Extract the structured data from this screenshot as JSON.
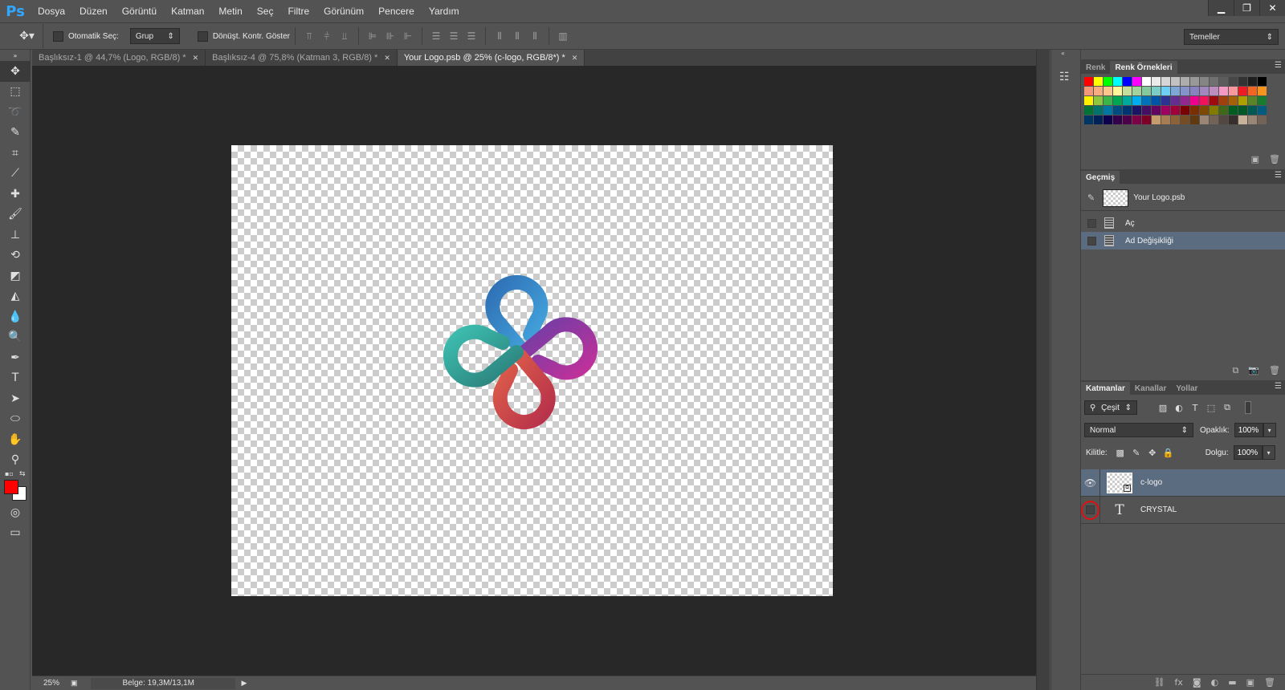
{
  "app": {
    "logo": "Ps"
  },
  "menu": [
    "Dosya",
    "Düzen",
    "Görüntü",
    "Katman",
    "Metin",
    "Seç",
    "Filtre",
    "Görünüm",
    "Pencere",
    "Yardım"
  ],
  "window_controls": {
    "minimize": "▁",
    "restore": "❐",
    "close": "✕"
  },
  "options": {
    "auto_select_label": "Otomatik Seç:",
    "auto_select_value": "Grup",
    "transform_label": "Dönüşt. Kontr. Göster",
    "workspace": "Temeller"
  },
  "tabs": [
    {
      "label": "Başlıksız-1 @ 44,7% (Logo, RGB/8) *"
    },
    {
      "label": "Başlıksız-4 @ 75,8% (Katman 3, RGB/8) *"
    },
    {
      "label": "Your Logo.psb @ 25% (c-logo, RGB/8*) *"
    }
  ],
  "status": {
    "zoom": "25%",
    "doc": "Belge: 19,3M/13,1M"
  },
  "colors": {
    "foreground": "#ff0000",
    "background": "#ffffff"
  },
  "swatches_panel": {
    "tabs": [
      "Renk",
      "Renk Örnekleri"
    ]
  },
  "history_panel": {
    "tab": "Geçmiş",
    "snapshot": "Your Logo.psb",
    "steps": [
      "Aç",
      "Ad Değişikliği"
    ]
  },
  "layers_panel": {
    "tabs": [
      "Katmanlar",
      "Kanallar",
      "Yollar"
    ],
    "filter": "Çeşit",
    "blend_mode": "Normal",
    "opacity_label": "Opaklık:",
    "opacity": "100%",
    "lock_label": "Kilitle:",
    "fill_label": "Dolgu:",
    "fill": "100%",
    "layers": [
      {
        "name": "c-logo"
      },
      {
        "name": "CRYSTAL"
      }
    ]
  }
}
